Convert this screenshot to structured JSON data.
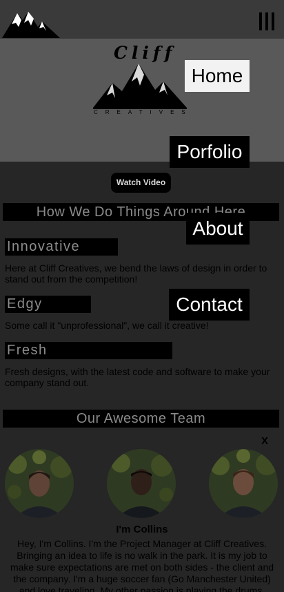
{
  "header": {
    "logo_icon": "mountain-logo-icon",
    "menu_icon": "hamburger-icon"
  },
  "hero": {
    "brand_name": "Cliff",
    "brand_sub": "CREATIVES",
    "watch_video": "Watch Video"
  },
  "nav": {
    "home": "Home",
    "porfolio": "Porfolio",
    "about": "About",
    "contact": "Contact",
    "close": "X"
  },
  "how": {
    "heading": "How We Do Things Around Here",
    "features": [
      {
        "title": "Innovative",
        "text": "Here at Cliff Creatives, we bend the laws of design in order to stand out from the competition!"
      },
      {
        "title": "Edgy",
        "text": "Some call it \"unprofessional\", we call it creative!"
      },
      {
        "title": "Fresh",
        "text": "Fresh designs, with the latest code and software to make your company stand out."
      }
    ]
  },
  "team": {
    "heading": "Our Awesome Team",
    "member_name": "I'm Collins",
    "member_bio": "Hey, I'm Collins. I'm the Project Manager at Cliff Creatives. Bringing an idea to life is no walk in the park. It is my job to make sure expectations are met on both sides - the client and the company. I'm a huge soccer fan (Go Manchester United) and love traveling. My other passion is playing the drums."
  },
  "colors": {
    "background": "#262626",
    "hero": "#595959",
    "topbar": "#3a3a3a",
    "heading_text": "#8a8a8a"
  }
}
